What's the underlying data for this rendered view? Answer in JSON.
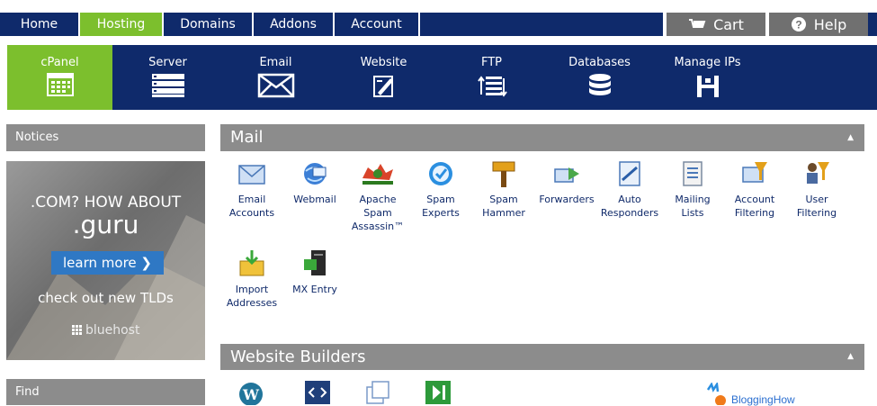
{
  "top_nav": {
    "tabs": [
      {
        "label": "Home"
      },
      {
        "label": "Hosting"
      },
      {
        "label": "Domains"
      },
      {
        "label": "Addons"
      },
      {
        "label": "Account"
      }
    ],
    "cart_label": "Cart",
    "help_label": "Help"
  },
  "sub_nav": {
    "items": [
      {
        "label": "cPanel",
        "icon": "cpanel-grid-icon"
      },
      {
        "label": "Server",
        "icon": "server-rack-icon"
      },
      {
        "label": "Email",
        "icon": "envelope-icon"
      },
      {
        "label": "Website",
        "icon": "website-edit-icon"
      },
      {
        "label": "FTP",
        "icon": "ftp-transfer-icon"
      },
      {
        "label": "Databases",
        "icon": "database-icon"
      },
      {
        "label": "Manage IPs",
        "icon": "manage-ips-icon"
      }
    ]
  },
  "sidebar": {
    "notices_title": "Notices",
    "find_title": "Find",
    "ad": {
      "line1": ".COM? HOW ABOUT",
      "line2": ".guru",
      "button": "learn more ❯",
      "line3": "check out new TLDs",
      "brand": "bluehost"
    }
  },
  "main": {
    "mail_title": "Mail",
    "mail_items": [
      {
        "label": "Email Accounts",
        "icon": "email-accounts-icon"
      },
      {
        "label": "Webmail",
        "icon": "webmail-icon"
      },
      {
        "label": "Apache Spam Assassin™",
        "icon": "spam-assassin-icon"
      },
      {
        "label": "Spam Experts",
        "icon": "spam-experts-icon"
      },
      {
        "label": "Spam Hammer",
        "icon": "spam-hammer-icon"
      },
      {
        "label": "Forwarders",
        "icon": "forwarders-icon"
      },
      {
        "label": "Auto Responders",
        "icon": "auto-responders-icon"
      },
      {
        "label": "Mailing Lists",
        "icon": "mailing-lists-icon"
      },
      {
        "label": "Account Filtering",
        "icon": "account-filtering-icon"
      },
      {
        "label": "User Filtering",
        "icon": "user-filtering-icon"
      },
      {
        "label": "Import Addresses",
        "icon": "import-addresses-icon"
      },
      {
        "label": "MX Entry",
        "icon": "mx-entry-icon"
      }
    ],
    "builders_title": "Website Builders",
    "builders_partner": "BloggingHow"
  },
  "colors": {
    "navy": "#0f2a6b",
    "green_active": "#7cbf2d",
    "gray_header": "#8c8c8c",
    "link_blue": "#102a6a"
  }
}
